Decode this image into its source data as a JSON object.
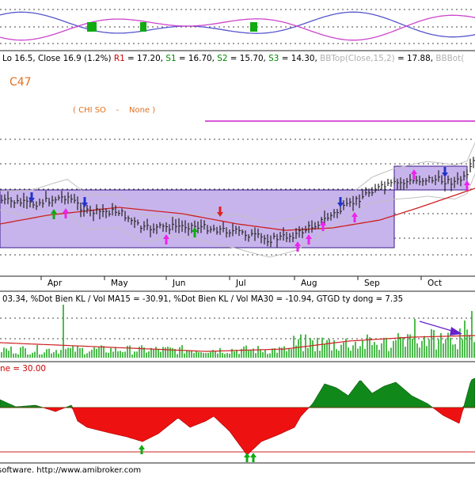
{
  "header": {
    "segments": [
      {
        "text": "Lo 16.5, Close 16.9 (1.2%) ",
        "color": "#000000"
      },
      {
        "text": "R1",
        "color": "#cc0000"
      },
      {
        "text": " = 17.20, ",
        "color": "#000000"
      },
      {
        "text": "S1",
        "color": "#008800"
      },
      {
        "text": " = 16.70, ",
        "color": "#000000"
      },
      {
        "text": "S2",
        "color": "#008800"
      },
      {
        "text": " = 15.70, ",
        "color": "#000000"
      },
      {
        "text": "S3",
        "color": "#008800"
      },
      {
        "text": " = 14.30, ",
        "color": "#000000"
      },
      {
        "text": "BBTop(Close,15,2)",
        "color": "#b0b0b0"
      },
      {
        "text": " = 17.88, ",
        "color": "#000000"
      },
      {
        "text": "BBBot(",
        "color": "#b0b0b0"
      }
    ]
  },
  "ticker": "C47",
  "ticker_color": "#e07020",
  "subtitle": "( CHI SO    -    None )",
  "months": [
    "Apr",
    "May",
    "Jun",
    "Jul",
    "Aug",
    "Sep",
    "Oct"
  ],
  "volume_header": "03.34, %Dot Bien KL / Vol MA15 = -30.91, %Dot Bien KL / Vol MA30 = -10.94, GTGD ty dong = 7.35",
  "oscillator_header": "ne = 30.00",
  "footer": "software. http://www.amibroker.com",
  "colors": {
    "box": "#c8b4ec",
    "box_border": "#3a1a8a",
    "ma_line": "#cc2222",
    "bb_line": "#b0b0b0",
    "price_bar": "#222222",
    "volume_bar": "#22aa22",
    "volume_ma": "#cc2222",
    "osc_pos": "#11881a",
    "osc_neg": "#ee1111",
    "wave_a": "#5555cc",
    "wave_b": "#cc44cc",
    "signal_green": "#11aa11",
    "signal_pink": "#ee22ee",
    "signal_blue": "#2233cc",
    "signal_red": "#dd2222"
  },
  "chart_data": [
    {
      "type": "line",
      "name": "price",
      "x": [
        "Apr",
        "May",
        "Jun",
        "Jul",
        "Aug",
        "Sep",
        "Oct"
      ],
      "close": [
        15.0,
        14.2,
        13.6,
        13.3,
        13.8,
        16.2,
        16.9
      ],
      "ma": [
        14.3,
        14.5,
        14.0,
        13.6,
        13.9,
        14.9,
        16.4
      ],
      "last_close": 16.9
    },
    {
      "type": "bar",
      "name": "volume",
      "x": [
        "Apr",
        "May",
        "Jun",
        "Jul",
        "Aug",
        "Sep",
        "Oct"
      ],
      "ma15_pct": -30.91,
      "ma30_pct": -10.94,
      "value_bn": 7.35
    },
    {
      "type": "area",
      "name": "oscillator",
      "x": [
        "Apr",
        "May",
        "Jun",
        "Jul",
        "Aug",
        "Sep",
        "Oct"
      ],
      "reference": 30.0
    }
  ]
}
